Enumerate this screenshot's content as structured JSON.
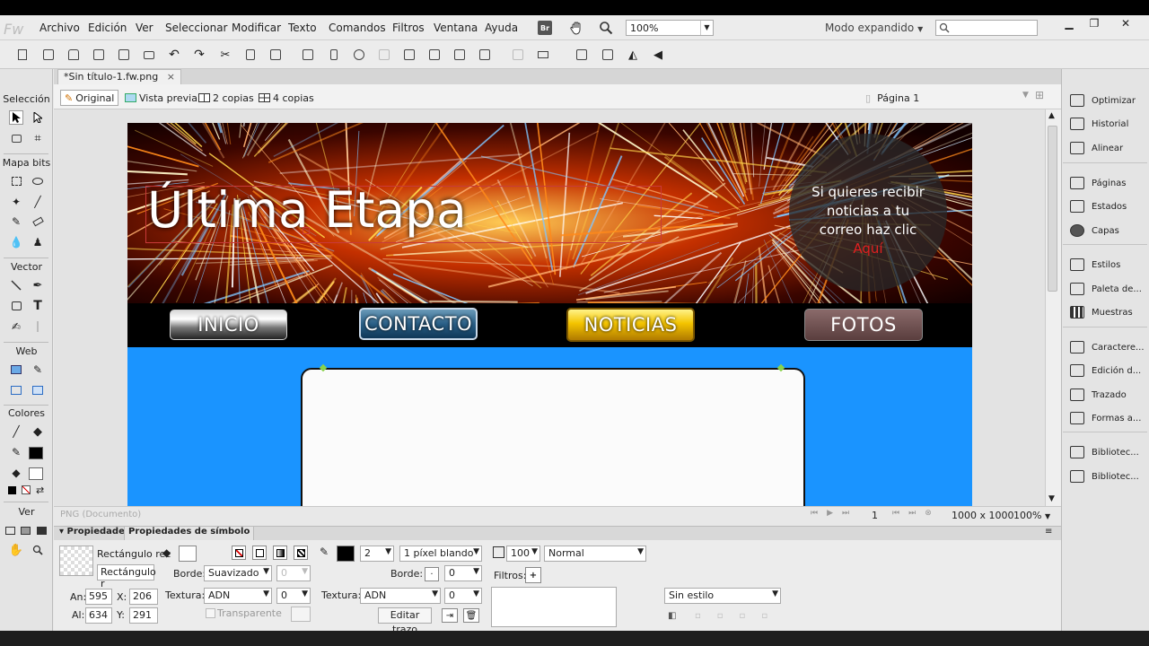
{
  "app": {
    "name": "Fw"
  },
  "menu": [
    "Archivo",
    "Edición",
    "Ver",
    "Seleccionar",
    "Modificar",
    "Texto",
    "Comandos",
    "Filtros",
    "Ventana",
    "Ayuda"
  ],
  "menubar": {
    "br_label": "Br",
    "zoom": "100%",
    "workspace": "Modo expandido"
  },
  "document": {
    "tab_title": "*Sin título-1.fw.png",
    "close": "×"
  },
  "view_modes": {
    "original": "Original",
    "preview": "Vista previa",
    "two_up": "2 copias",
    "four_up": "4 copias",
    "page": "Página 1"
  },
  "tool_sections": {
    "seleccion": "Selección",
    "mapa_bits": "Mapa bits",
    "vector": "Vector",
    "web": "Web",
    "colores": "Colores",
    "ver": "Ver"
  },
  "canvas": {
    "title": "Última Etapa",
    "promo_lines": [
      "Si quieres recibir",
      "noticias a tu",
      "correo haz clic"
    ],
    "promo_link": "Aquí",
    "nav": [
      "INICIO",
      "CONTACTO",
      "NOTICIAS",
      "FOTOS"
    ],
    "colors": {
      "nav_bg": "#000000",
      "body_bg": "#1a94ff",
      "promo_link": "#e02020",
      "noticias": "#f4c400"
    }
  },
  "status": {
    "doc_type": "PNG (Documento)",
    "page": "1",
    "size": "1000 x 1000",
    "zoom": "100%"
  },
  "right_panels": [
    "Optimizar",
    "Historial",
    "Alinear",
    "Páginas",
    "Estados",
    "Capas",
    "Estilos",
    "Paleta de...",
    "Muestras",
    "Caractere...",
    "Edición d...",
    "Trazado",
    "Formas a...",
    "Bibliotec...",
    "Bibliotec..."
  ],
  "properties": {
    "tab_props": "Propiedades",
    "tab_symbol": "Propiedades de símbolo",
    "object_type": "Rectángulo rec",
    "object_name": "Rectángulo r",
    "width_label": "An:",
    "width": "595",
    "height_label": "Al:",
    "height": "634",
    "x_label": "X:",
    "x": "206",
    "y_label": "Y:",
    "y": "291",
    "borde_label": "Borde:",
    "borde_fill": "Suavizado",
    "borde_fill_val": "0",
    "textura_label": "Textura:",
    "textura_fill": "ADN",
    "textura_fill_val": "0",
    "transparente": "Transparente",
    "stroke_size": "2",
    "stroke_type": "1 píxel blando",
    "stroke_borde_val": "0",
    "stroke_textura": "ADN",
    "stroke_textura_val": "0",
    "editar_trazo": "Editar trazo",
    "opacity": "100",
    "blend": "Normal",
    "filtros_label": "Filtros:",
    "style": "Sin estilo"
  }
}
